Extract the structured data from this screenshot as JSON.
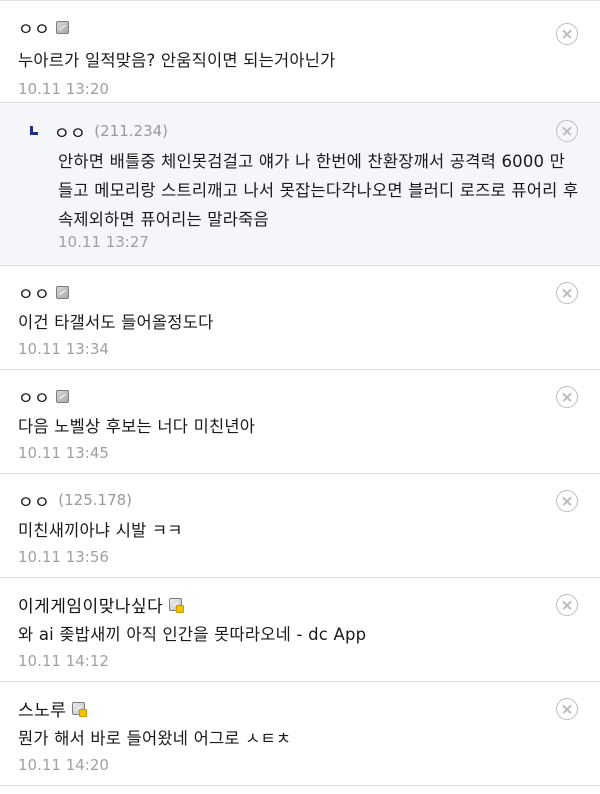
{
  "comments": [
    {
      "nick": "ㅇㅇ",
      "ip": "",
      "icon": "gallog-icon",
      "body": "누아르가 일적맞음? 안움직이면 되는거아닌가",
      "date": "10.11 13:20"
    },
    {
      "nick": "ㅇㅇ",
      "ip": "(211.234)",
      "reply": true,
      "body": "안하면 배틀중 체인못검걸고 얘가 나 한번에 찬환장깨서 공격력 6000 만들고 메모리랑 스트리깨고 나서 못잡는다각나오면 블러디 로즈로 퓨어리 후속제외하면 퓨어리는 말라죽음",
      "date": "10.11 13:27"
    },
    {
      "nick": "ㅇㅇ",
      "ip": "",
      "icon": "gallog-icon",
      "body": "이건 타갤서도 들어올정도다",
      "date": "10.11 13:34"
    },
    {
      "nick": "ㅇㅇ",
      "ip": "",
      "icon": "gallog-icon",
      "body": "다음 노벨상 후보는 너다 미친년아",
      "date": "10.11 13:45"
    },
    {
      "nick": "ㅇㅇ",
      "ip": "(125.178)",
      "body": "미친새끼아냐 시발 ㅋㅋ",
      "date": "10.11 13:56"
    },
    {
      "nick": "이게게임이맞나싶다",
      "ip": "",
      "icon": "gallog-fixed-icon",
      "body": "와 ai 좆밥새끼 아직 인간을 못따라오네 - dc App",
      "date": "10.11 14:12"
    },
    {
      "nick": "스노루",
      "ip": "",
      "icon": "gallog-fixed-icon",
      "body": "뭔가 해서 바로 들어왔네 어그로 ㅅㅌㅊ",
      "date": "10.11 14:20"
    }
  ],
  "colors": {
    "reply_bg": "#f5f6fa",
    "divider": "#dcdcdc",
    "meta": "#a0a0a0",
    "reply_arrow": "#1e2f8f"
  }
}
